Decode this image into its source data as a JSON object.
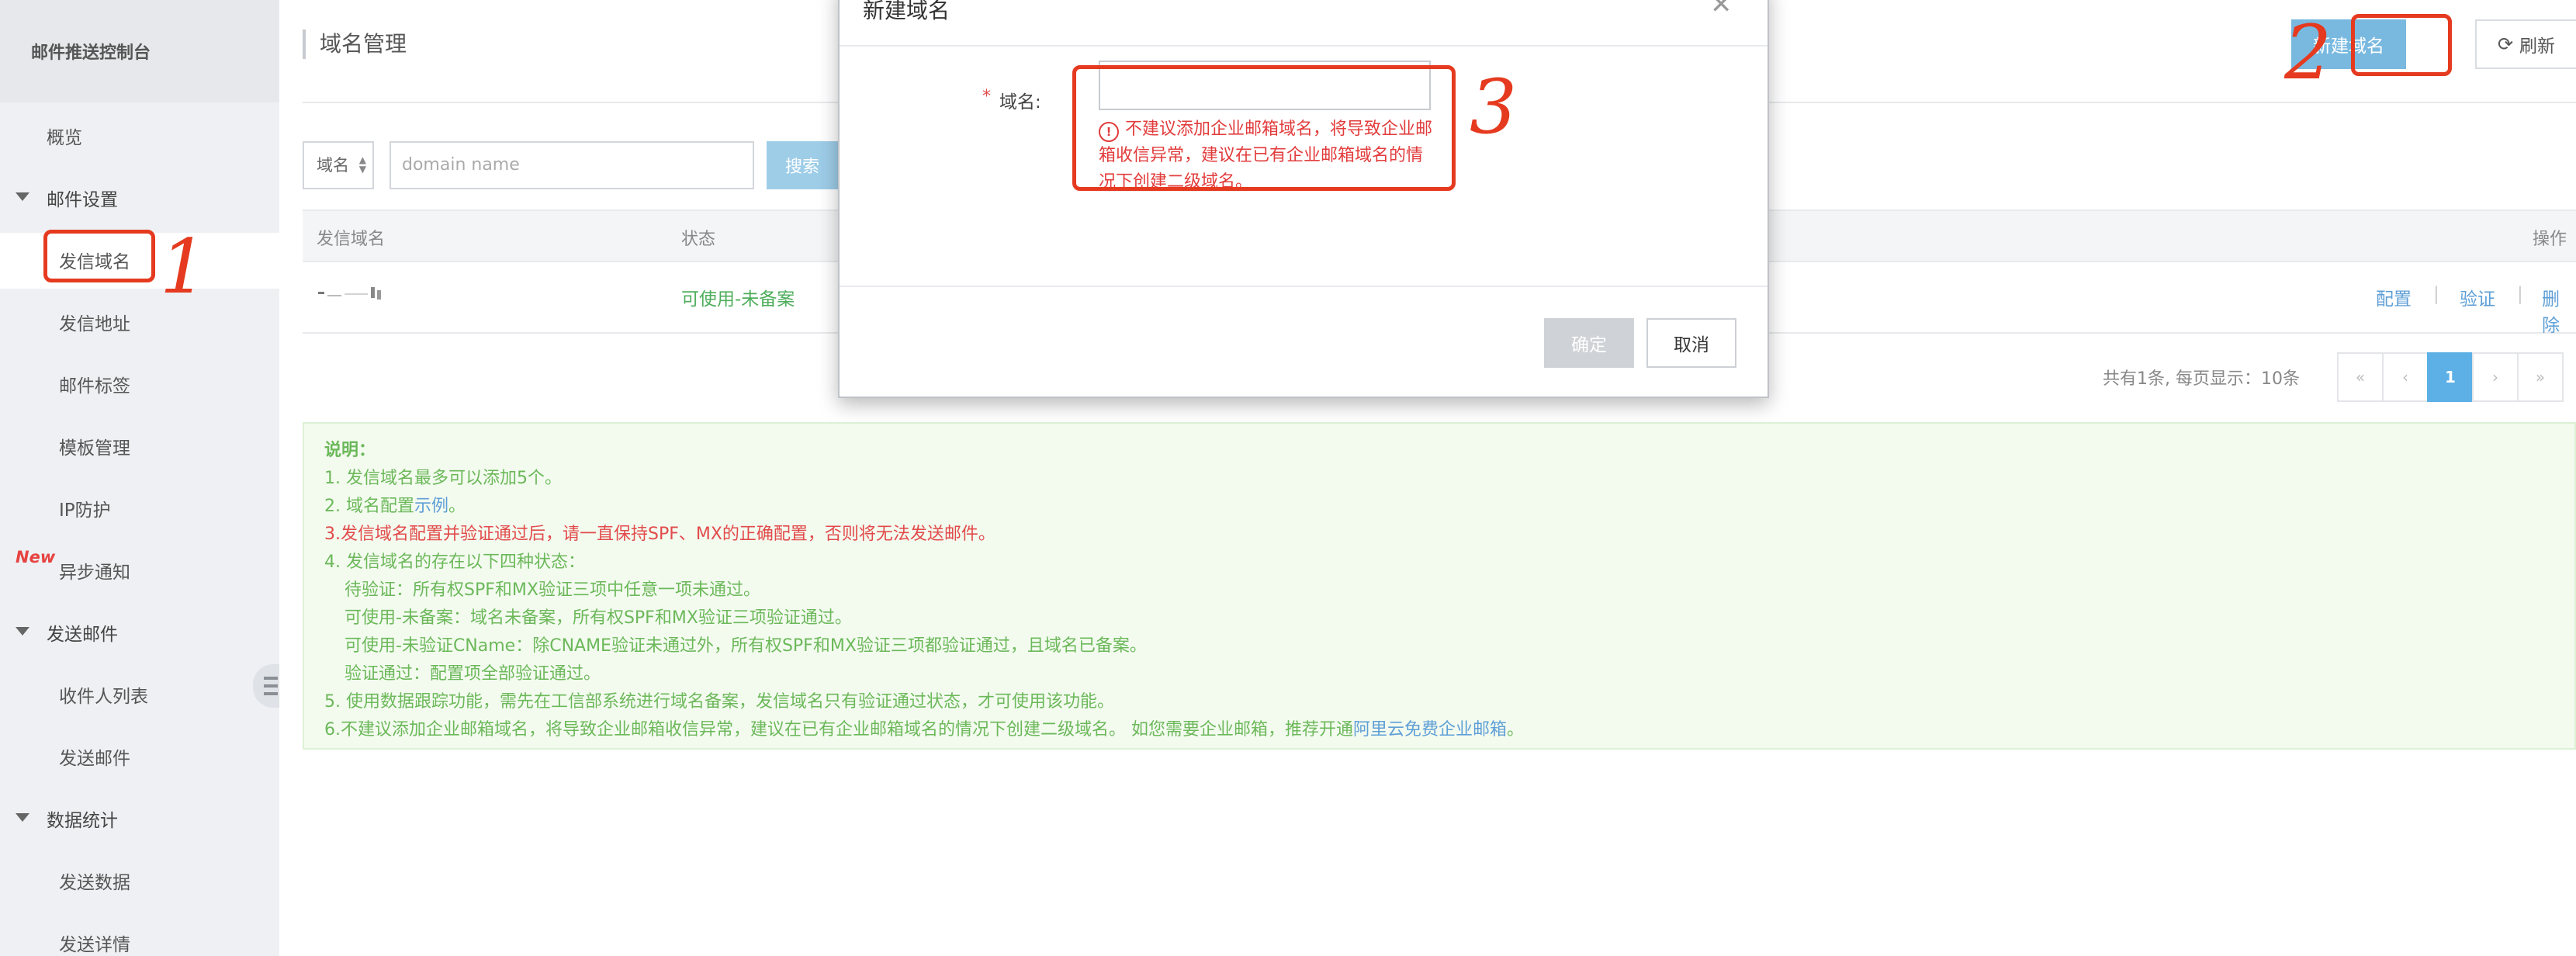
{
  "sidebar": {
    "brand": "邮件推送控制台",
    "items": [
      {
        "label": "概览"
      },
      {
        "label": "邮件设置"
      },
      {
        "label": "发信域名"
      },
      {
        "label": "发信地址"
      },
      {
        "label": "邮件标签"
      },
      {
        "label": "模板管理"
      },
      {
        "label": "IP防护"
      },
      {
        "label": "异步通知",
        "badge": "New"
      },
      {
        "label": "发送邮件"
      },
      {
        "label": "收件人列表"
      },
      {
        "label": "发送邮件"
      },
      {
        "label": "数据统计"
      },
      {
        "label": "发送数据"
      },
      {
        "label": "发送详情"
      }
    ]
  },
  "header": {
    "title": "域名管理",
    "new_button": "新建域名",
    "refresh_button": "刷新"
  },
  "search": {
    "select_value": "域名",
    "placeholder": "domain name",
    "button": "搜索"
  },
  "table": {
    "columns": [
      "发信域名",
      "状态",
      "操作"
    ],
    "rows": [
      {
        "domain": "",
        "status": "可使用-未备案",
        "actions": [
          "配置",
          "验证",
          "删除"
        ]
      }
    ]
  },
  "pagination": {
    "info": "共有1条, 每页显示：10条",
    "first": "«",
    "prev": "‹",
    "current": "1",
    "next": "›",
    "last": "»"
  },
  "notes": {
    "title": "说明：",
    "l1": "1. 发信域名最多可以添加5个。",
    "l2_pre": "2. 域名配置",
    "l2_link": "示例",
    "l2_post": "。",
    "l3": "3.发信域名配置并验证通过后，请一直保持SPF、MX的正确配置，否则将无法发送邮件。",
    "l4": "4. 发信域名的存在以下四种状态：",
    "l4a": "待验证：所有权SPF和MX验证三项中任意一项未通过。",
    "l4b": "可使用-未备案：域名未备案，所有权SPF和MX验证三项验证通过。",
    "l4c": "可使用-未验证CName：除CNAME验证未通过外，所有权SPF和MX验证三项都验证通过，且域名已备案。",
    "l4d": "验证通过：配置项全部验证通过。",
    "l5": "5. 使用数据跟踪功能，需先在工信部系统进行域名备案，发信域名只有验证通过状态，才可使用该功能。",
    "l6_pre": "6.不建议添加企业邮箱域名，将导致企业邮箱收信异常，建议在已有企业邮箱域名的情况下创建二级域名。 如您需要企业邮箱，推荐开通",
    "l6_link": "阿里云免费企业邮箱",
    "l6_post": "。"
  },
  "modal": {
    "title": "新建域名",
    "close": "✕",
    "required_mark": "*",
    "field_label": "域名:",
    "error_icon": "!",
    "error_text": "不建议添加企业邮箱域名，将导致企业邮箱收信异常，建议在已有企业邮箱域名的情况下创建二级域名。",
    "ok": "确定",
    "cancel": "取消"
  },
  "annotations": {
    "n1": "1",
    "n2": "2",
    "n3": "3"
  },
  "colors": {
    "accent": "#5cb0e6",
    "annotation": "#e53a1f",
    "success": "#4fae5c",
    "error": "#e23c3c",
    "notes_bg": "#f3fbef"
  }
}
